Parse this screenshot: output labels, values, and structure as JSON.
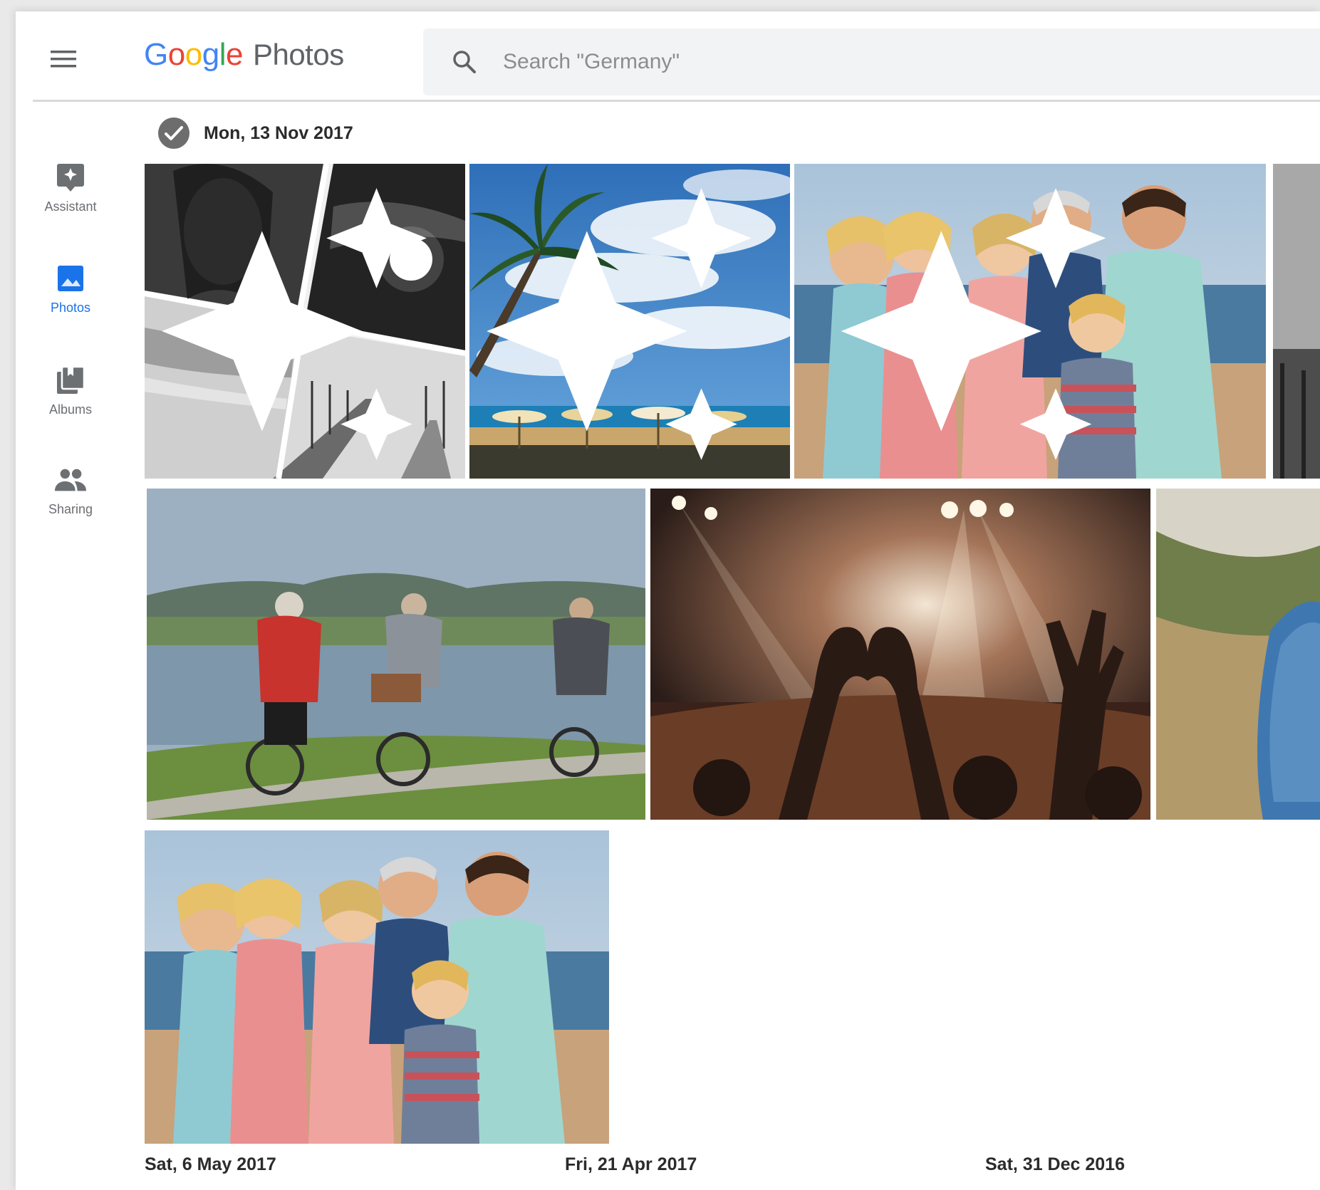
{
  "app": {
    "logo_google": [
      "G",
      "o",
      "o",
      "g",
      "l",
      "e"
    ],
    "logo_product": "Photos",
    "colors": {
      "google_blue": "#4285f4",
      "google_red": "#ea4335",
      "google_yellow": "#fbbc05",
      "google_green": "#34a853",
      "active_nav": "#1a73e8"
    }
  },
  "header": {
    "menu_icon": "hamburger-menu-icon",
    "search": {
      "icon": "search-icon",
      "placeholder": "Search \"Germany\"",
      "value": ""
    }
  },
  "sidebar": {
    "items": [
      {
        "label": "Assistant",
        "icon": "assistant-icon",
        "active": false
      },
      {
        "label": "Photos",
        "icon": "photos-icon",
        "active": true
      },
      {
        "label": "Albums",
        "icon": "albums-icon",
        "active": false
      },
      {
        "label": "Sharing",
        "icon": "sharing-icon",
        "active": false
      }
    ]
  },
  "main": {
    "sections": [
      {
        "date": "Mon, 13 Nov 2017",
        "selected": true,
        "photos": [
          {
            "subject": "black and white collage",
            "icon": "auto-creation-sparkle-icon"
          },
          {
            "subject": "palm tree beach",
            "icon": "auto-creation-sparkle-icon"
          },
          {
            "subject": "family on beach",
            "icon": "auto-creation-sparkle-icon"
          },
          {
            "subject": "pier",
            "icon": ""
          },
          {
            "subject": "cyclists by lake",
            "icon": ""
          },
          {
            "subject": "concert crowd",
            "icon": ""
          },
          {
            "subject": "hillside person",
            "icon": ""
          },
          {
            "subject": "family on beach",
            "icon": ""
          }
        ]
      }
    ],
    "following_dates": [
      "Sat, 6 May 2017",
      "Fri, 21 Apr 2017",
      "Sat, 31 Dec 2016"
    ]
  }
}
